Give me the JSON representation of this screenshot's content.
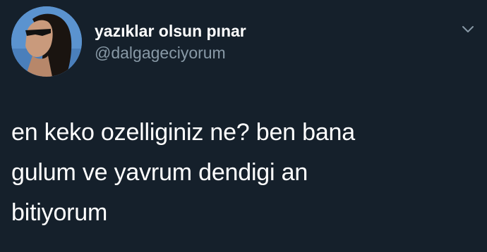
{
  "tweet": {
    "author": {
      "display_name": "yazıklar olsun pınar",
      "handle": "@dalgageciyorum",
      "avatar_icon": "profile-photo"
    },
    "menu_icon": "chevron-down-icon",
    "text_lines": [
      "en keko ozelliginiz ne? ben bana",
      "gulum ve yavrum dendigi an",
      "bitiyorum"
    ]
  },
  "colors": {
    "background": "#15202b",
    "primary_text": "#ffffff",
    "secondary_text": "#8899a6"
  }
}
